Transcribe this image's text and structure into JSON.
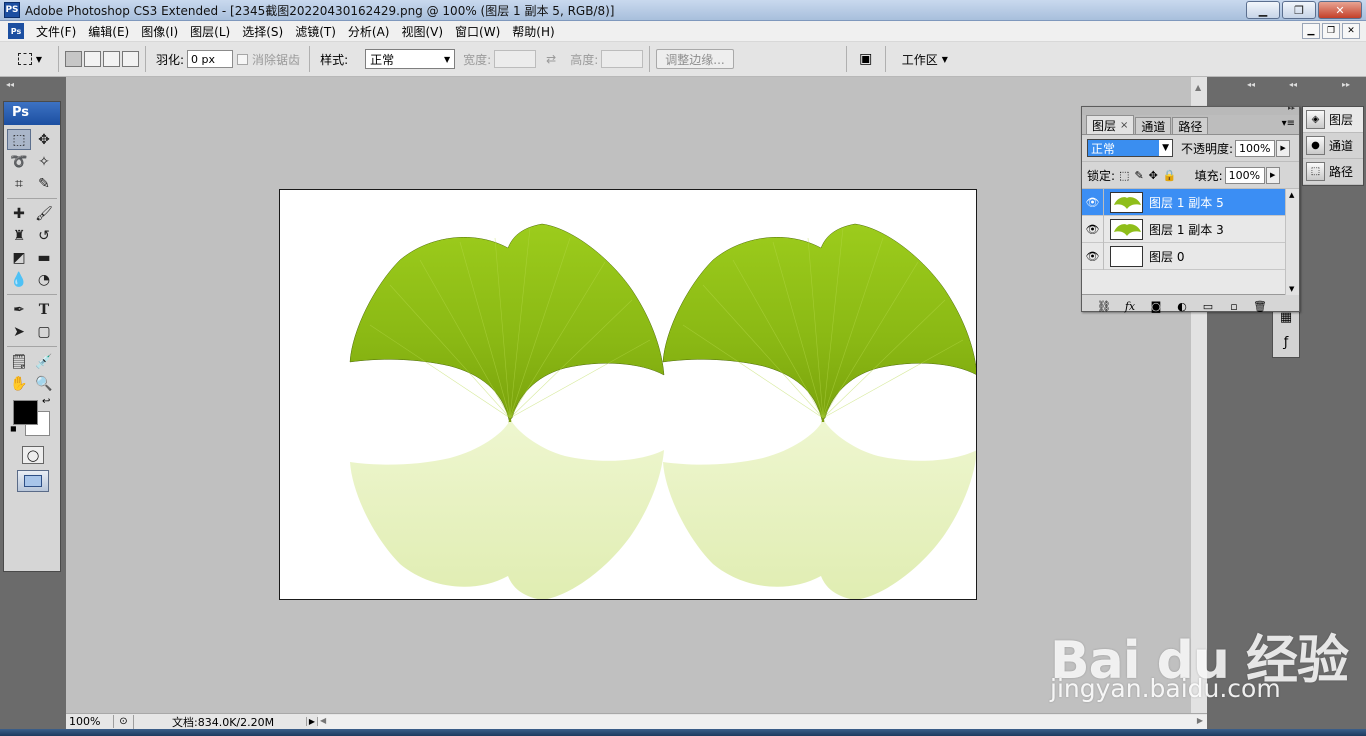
{
  "window": {
    "app_icon": "PS",
    "title": "Adobe Photoshop CS3 Extended - [2345截图20220430162429.png @ 100% (图层 1 副本 5, RGB/8)]",
    "controls": [
      "minimize-icon",
      "maximize-icon",
      "close-icon"
    ]
  },
  "menubar": {
    "items": [
      "文件(F)",
      "编辑(E)",
      "图像(I)",
      "图层(L)",
      "选择(S)",
      "滤镜(T)",
      "分析(A)",
      "视图(V)",
      "窗口(W)",
      "帮助(H)"
    ]
  },
  "options": {
    "feather_label": "羽化:",
    "feather_value": "0 px",
    "antialias_label": "消除锯齿",
    "style_label": "样式:",
    "style_value": "正常",
    "width_label": "宽度:",
    "height_label": "高度:",
    "refine_edge": "调整边缘...",
    "workspace": "工作区"
  },
  "toolbox": {
    "header": "Ps",
    "foreground_color": "#000000",
    "background_color": "#ffffff"
  },
  "document": {
    "canvas_bg": "#ffffff",
    "leaf_color": "#8fbe1a",
    "reflection_color": "#e7f2bf"
  },
  "statusbar": {
    "zoom": "100%",
    "doc_info": "文档:834.0K/2.20M"
  },
  "layers_panel": {
    "tabs": [
      "图层",
      "通道",
      "路径"
    ],
    "blend_mode": "正常",
    "opacity_label": "不透明度:",
    "opacity_value": "100%",
    "lock_label": "锁定:",
    "fill_label": "填充:",
    "fill_value": "100%",
    "layers": [
      {
        "name": "图层 1 副本 5",
        "selected": true
      },
      {
        "name": "图层 1 副本 3",
        "selected": false
      },
      {
        "name": "图层 0",
        "selected": false
      }
    ]
  },
  "right_dock": {
    "tabs": [
      "图层",
      "通道",
      "路径"
    ]
  },
  "watermark": {
    "brand": "Bai du 经验",
    "url": "jingyan.baidu.com"
  }
}
